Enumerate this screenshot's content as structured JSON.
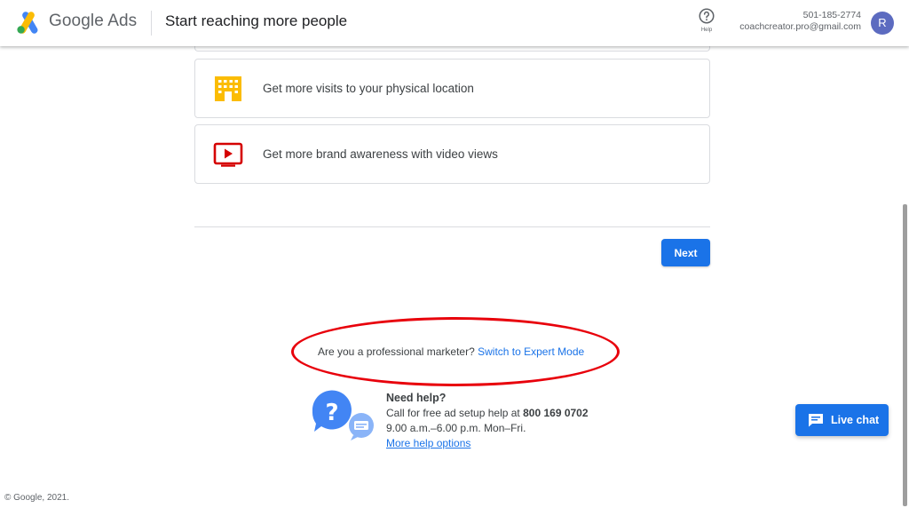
{
  "header": {
    "brand": "Google Ads",
    "title": "Start reaching more people",
    "help_label": "Help",
    "account_id": "501-185-2774",
    "account_email": "coachcreator.pro@gmail.com",
    "avatar_initial": "R"
  },
  "goals": [
    {
      "label": "Get more visits to your physical location",
      "icon": "store-icon"
    },
    {
      "label": "Get more brand awareness with video views",
      "icon": "video-play-icon"
    }
  ],
  "next_label": "Next",
  "expert": {
    "question": "Are you a professional marketer?",
    "link": "Switch to Expert Mode"
  },
  "need_help": {
    "title": "Need help?",
    "call_text": "Call for free ad setup help at",
    "phone": "800 169 0702",
    "hours": "9.00 a.m.–6.00 p.m. Mon–Fri.",
    "more_link": "More help options"
  },
  "live_chat_label": "Live chat",
  "footer": "© Google, 2021.",
  "colors": {
    "primary": "#1a73e8",
    "highlight_ring": "#e8000b",
    "store_icon": "#fbbc04",
    "video_icon": "#d50000"
  }
}
